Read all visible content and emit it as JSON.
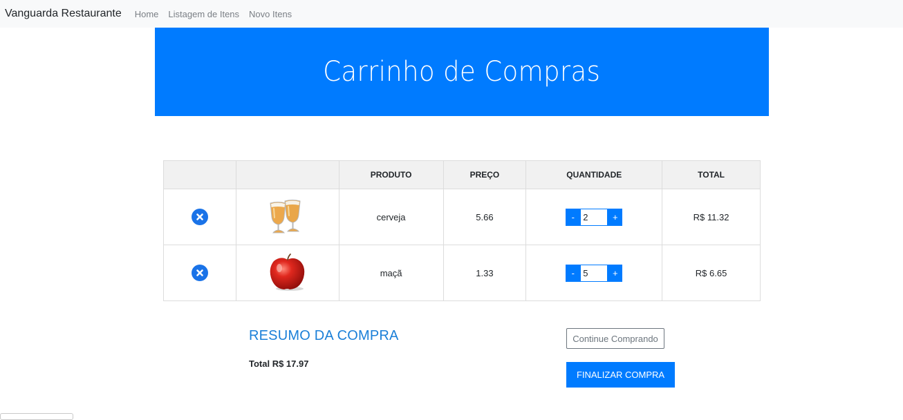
{
  "navbar": {
    "brand": "Vanguarda Restaurante",
    "links": [
      {
        "label": "Home"
      },
      {
        "label": "Listagem de Itens"
      },
      {
        "label": "Novo Itens"
      }
    ]
  },
  "hero": {
    "title": "Carrinho de Compras",
    "background": "#007bff"
  },
  "table": {
    "headers": [
      "",
      "",
      "PRODUTO",
      "PREÇO",
      "QUANTIDADE",
      "TOTAL"
    ],
    "rows": [
      {
        "remove_icon": "remove-circle-icon",
        "image": "beer-glasses",
        "product": "cerveja",
        "price": "5.66",
        "quantity": "2",
        "total": "R$ 11.32"
      },
      {
        "remove_icon": "remove-circle-icon",
        "image": "red-apple",
        "product": "maçã",
        "price": "1.33",
        "quantity": "5",
        "total": "R$ 6.65"
      }
    ],
    "decrement_label": "-",
    "increment_label": "+"
  },
  "summary": {
    "title": "RESUMO DA COMPRA",
    "total_text": "Total R$ 17.97"
  },
  "actions": {
    "continue_label": "Continue Comprando",
    "finish_label": "FINALIZAR COMPRA"
  },
  "colors": {
    "primary": "#007bff",
    "summary_title": "#1a7fd8",
    "navbar_bg": "#f8f9fa"
  }
}
